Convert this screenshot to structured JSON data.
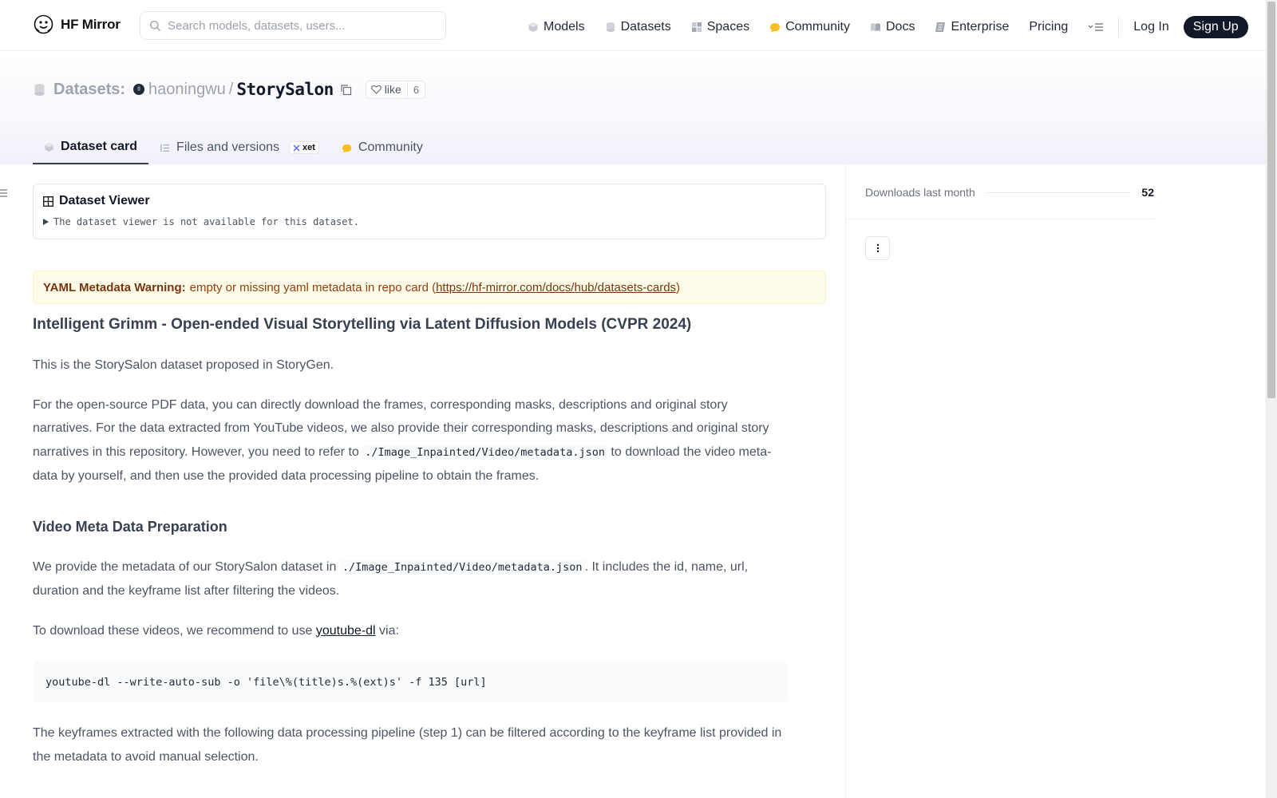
{
  "nav": {
    "brand": "HF Mirror",
    "search_placeholder": "Search models, datasets, users...",
    "links": [
      "Models",
      "Datasets",
      "Spaces",
      "Community",
      "Docs",
      "Enterprise",
      "Pricing"
    ],
    "login": "Log In",
    "signup": "Sign Up"
  },
  "header": {
    "type_label": "Datasets:",
    "owner": "haoningwu",
    "separator": "/",
    "repo": "StorySalon",
    "like_label": "like",
    "like_count": "6",
    "tabs": [
      "Dataset card",
      "Files and versions",
      "Community"
    ],
    "xet_badge": "xet"
  },
  "viewer": {
    "title": "Dataset Viewer",
    "note": "The dataset viewer is not available for this dataset."
  },
  "warning": {
    "label": "YAML Metadata Warning:",
    "text": "empty or missing yaml metadata in repo card (",
    "link": "https://hf-mirror.com/docs/hub/datasets-cards",
    "close": ")"
  },
  "content": {
    "title": "Intelligent Grimm - Open-ended Visual Storytelling via Latent Diffusion Models (CVPR 2024)",
    "p1": "This is the StorySalon dataset proposed in StoryGen.",
    "p2_a": "For the open-source PDF data, you can directly download the frames, corresponding masks, descriptions and original story narratives. For the data extracted from YouTube videos, we also provide their corresponding masks, descriptions and original story narratives in this repository. However, you need to refer to ",
    "p2_code": "./Image_Inpainted/Video/metadata.json",
    "p2_b": " to download the video meta-data by yourself, and then use the provided data processing pipeline to obtain the frames.",
    "section": "Video Meta Data Preparation",
    "p3_a": "We provide the metadata of our StorySalon dataset in ",
    "p3_code": "./Image_Inpainted/Video/metadata.json",
    "p3_b": ". It includes the id, name, url, duration and the keyframe list after filtering the videos.",
    "p4_a": "To download these videos, we recommend to use ",
    "p4_link": "youtube-dl",
    "p4_b": " via:",
    "code": "youtube-dl --write-auto-sub -o 'file\\%(title)s.%(ext)s' -f 135 [url]",
    "p5": "The keyframes extracted with the following data processing pipeline (step 1) can be filtered according to the keyframe list provided in the metadata to avoid manual selection."
  },
  "sidebar": {
    "downloads_label": "Downloads last month",
    "downloads_count": "52"
  },
  "icons": {
    "brand": "hugging-face-logo",
    "search": "search-icon",
    "models": "cube-icon",
    "datasets": "database-icon",
    "spaces": "grid-icon",
    "community": "community-icon",
    "docs": "book-icon",
    "enterprise": "enterprise-icon",
    "more": "menu-icon"
  },
  "colors": {
    "signup_bg": "#111827",
    "warning_bg": "#fefce8",
    "warning_text": "#92400e",
    "community_yellow": "#fbbf24"
  }
}
